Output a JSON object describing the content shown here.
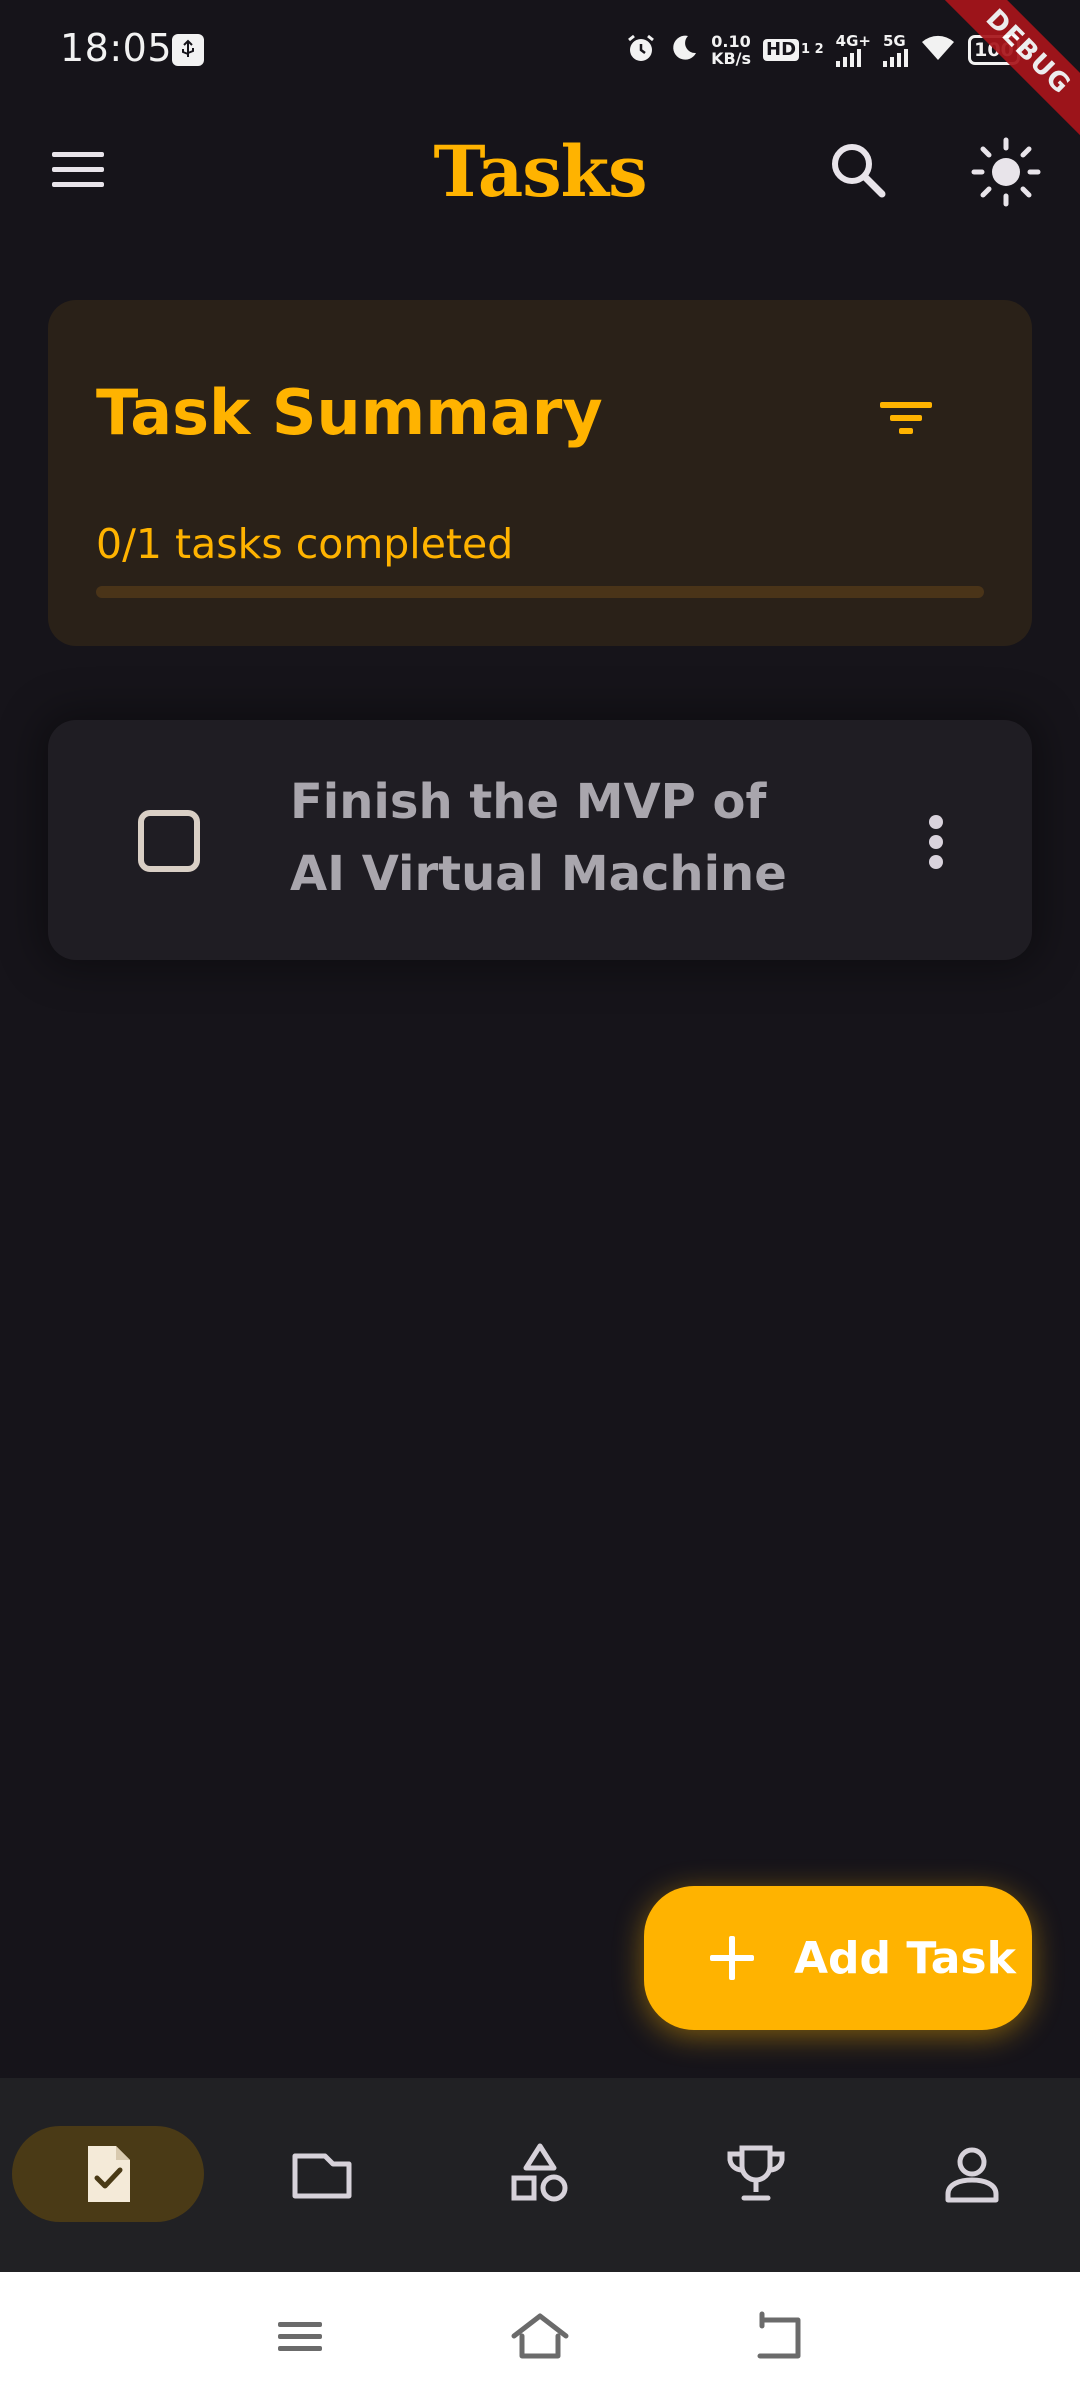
{
  "status_bar": {
    "time": "18:05",
    "net_speed_value": "0.10",
    "net_speed_unit": "KB/s",
    "hd_label": "HD",
    "hd_sub": "1 2",
    "net_4g": "4G+",
    "net_5g": "5G",
    "battery": "100",
    "debug_banner": "DEBUG"
  },
  "app_bar": {
    "title": "Tasks",
    "menu_icon": "menu-icon",
    "search_icon": "search-icon",
    "theme_icon": "sun-icon"
  },
  "summary": {
    "title": "Task Summary",
    "progress_text": "0/1 tasks completed",
    "completed": 0,
    "total": 1,
    "filter_icon": "filter-icon"
  },
  "tasks": [
    {
      "title": "Finish the MVP of AI Virtual Machine",
      "completed": false
    }
  ],
  "fab": {
    "label": "Add Task",
    "icon": "plus-icon"
  },
  "bottom_nav": {
    "items": [
      {
        "icon": "task-check-icon",
        "active": true
      },
      {
        "icon": "folder-icon",
        "active": false
      },
      {
        "icon": "shapes-icon",
        "active": false
      },
      {
        "icon": "trophy-icon",
        "active": false
      },
      {
        "icon": "profile-icon",
        "active": false
      }
    ]
  },
  "system_nav": {
    "items": [
      "menu-icon",
      "home-icon",
      "back-icon"
    ]
  },
  "colors": {
    "background": "#16141a",
    "accent": "#ffb300",
    "summary_card": "#2a2118",
    "task_card": "#1f1d23",
    "nav_bar": "#212124",
    "nav_active": "#4a3a16"
  }
}
